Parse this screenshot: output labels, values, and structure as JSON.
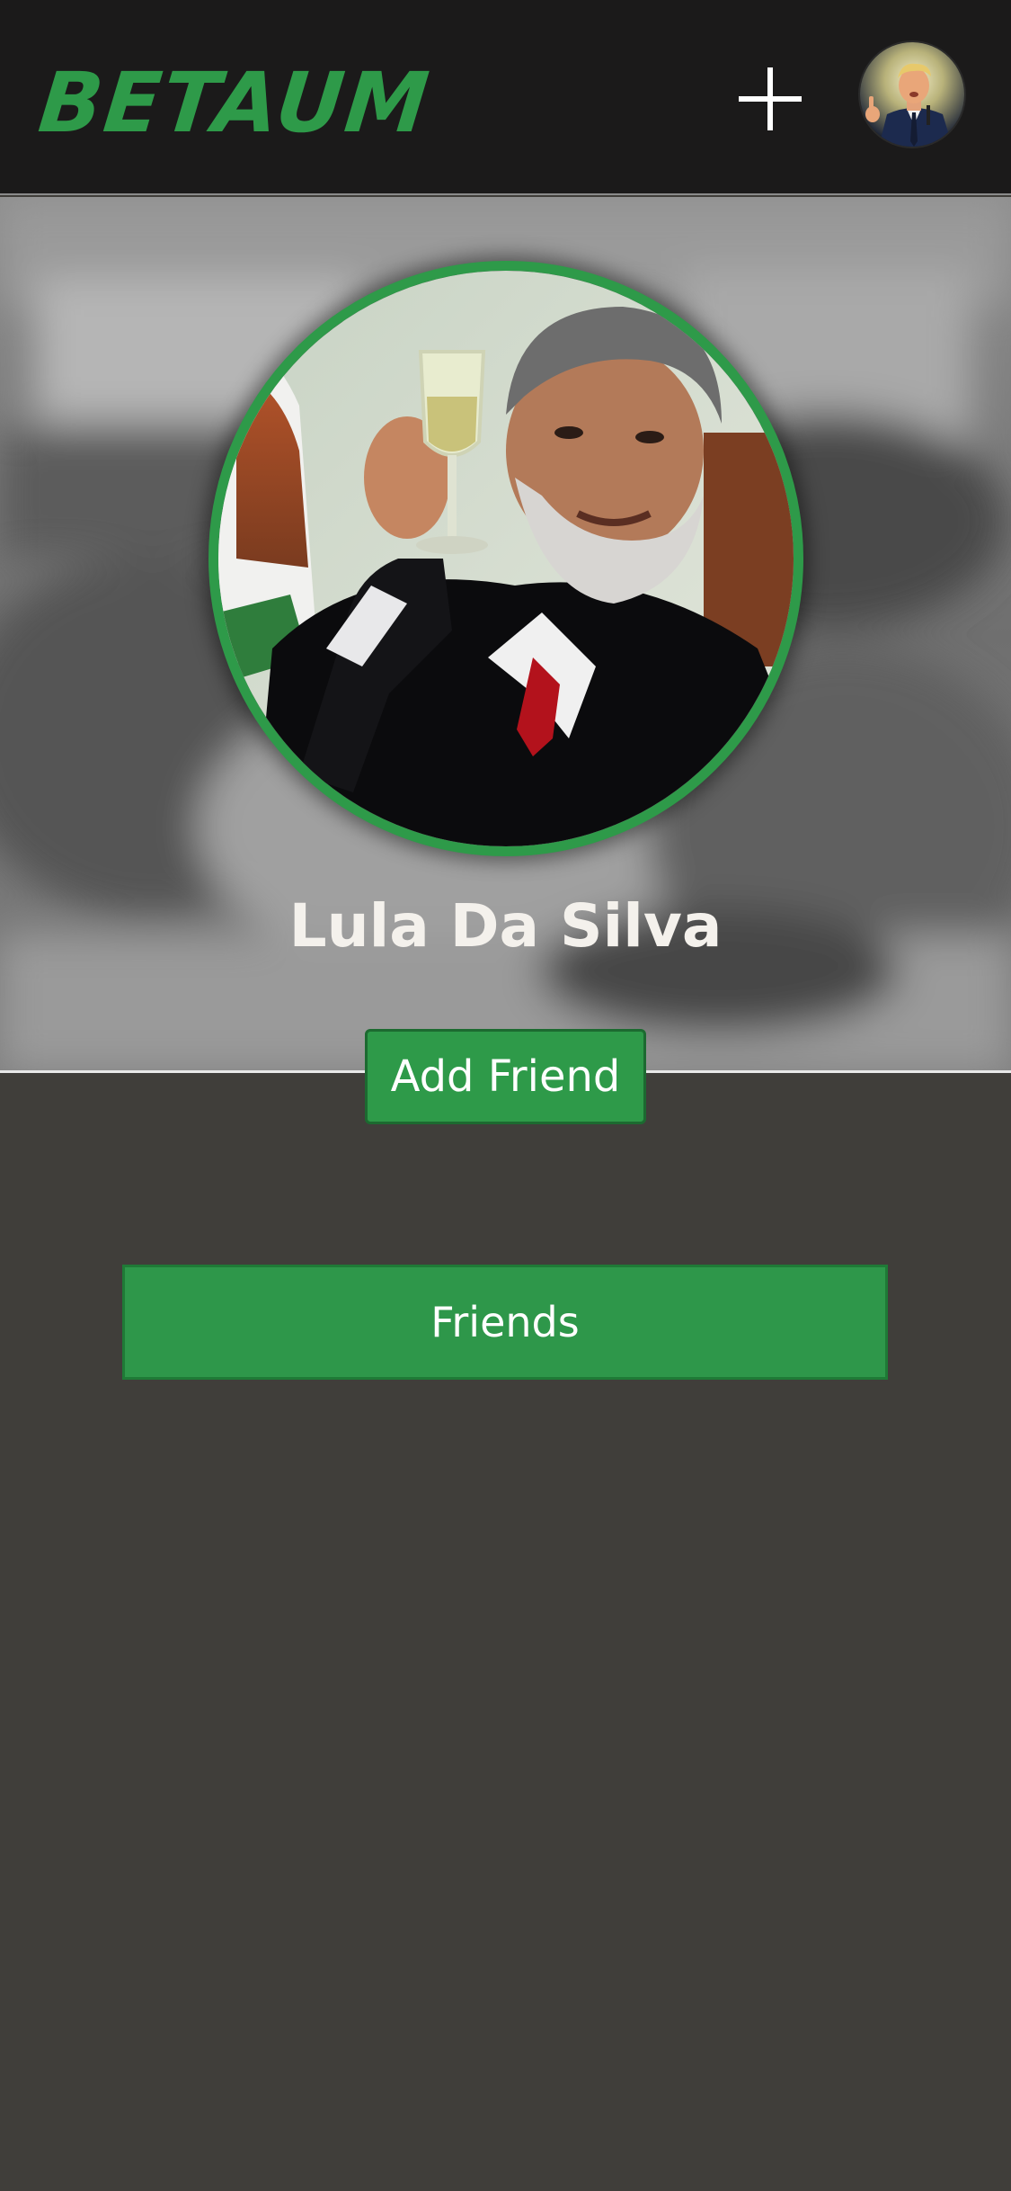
{
  "header": {
    "logo_text": "BETAUM",
    "add_icon": "plus-icon",
    "avatar": "user-avatar"
  },
  "profile": {
    "name": "Lula Da Silva",
    "add_friend_label": "Add Friend",
    "friends_label": "Friends"
  },
  "colors": {
    "brand_green": "#2e9a49",
    "header_bg": "#1b1a1a",
    "page_bg": "#403e3a",
    "text_light": "#f4f1ec"
  }
}
